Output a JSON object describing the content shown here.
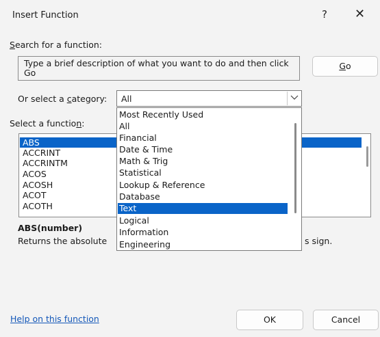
{
  "window": {
    "title": "Insert Function",
    "help_glyph": "?",
    "close_glyph": "✕"
  },
  "search": {
    "label_accel": "S",
    "label_rest": "earch for a function:",
    "value": "Type a brief description of what you want to do and then click Go",
    "go_accel": "G",
    "go_rest": "o"
  },
  "category": {
    "label_pre": "Or select a ",
    "label_accel": "c",
    "label_post": "ategory:",
    "selected": "All",
    "options": [
      "Most Recently Used",
      "All",
      "Financial",
      "Date & Time",
      "Math & Trig",
      "Statistical",
      "Lookup & Reference",
      "Database",
      "Text",
      "Logical",
      "Information",
      "Engineering"
    ],
    "highlighted_index": 8
  },
  "functions": {
    "label_pre": "Select a functio",
    "label_accel": "n",
    "label_post": ":",
    "items": [
      "ABS",
      "ACCRINT",
      "ACCRINTM",
      "ACOS",
      "ACOSH",
      "ACOT",
      "ACOTH"
    ],
    "selected_index": 0
  },
  "description": {
    "signature": "ABS(number)",
    "text_left": "Returns the absolute",
    "text_right": "s sign."
  },
  "footer": {
    "help_link": "Help on this function",
    "ok_label": "OK",
    "cancel_label": "Cancel"
  },
  "colors": {
    "selection": "#0a64c8",
    "link": "#1357b8",
    "dialog_bg": "#f3f3f3"
  }
}
